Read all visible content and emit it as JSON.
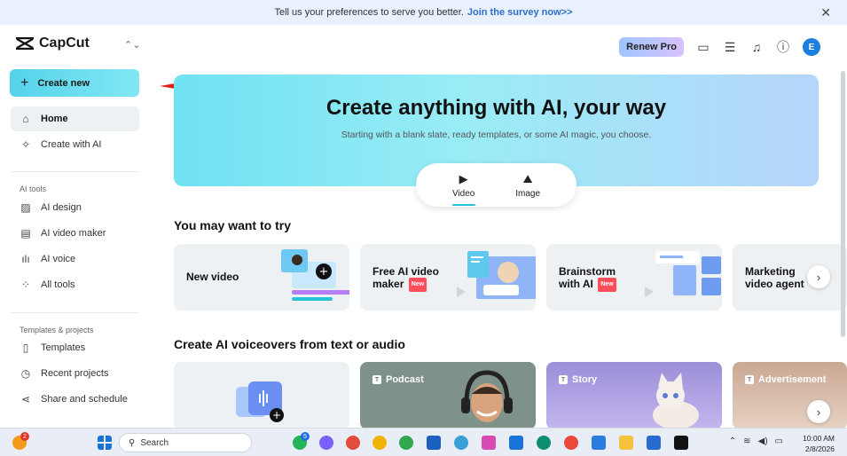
{
  "banner": {
    "text": "Tell us your preferences to serve you better.",
    "link": "Join the survey now>>",
    "close": "✕"
  },
  "sidebar": {
    "logo": "CapCut",
    "create_new": "Create new",
    "home": "Home",
    "create_with_ai": "Create with AI",
    "ai_tools_label": "AI tools",
    "ai_design": "AI design",
    "ai_video_maker": "AI video maker",
    "ai_voice": "AI voice",
    "all_tools": "All tools",
    "templates_label": "Templates & projects",
    "templates": "Templates",
    "recent_projects": "Recent projects",
    "share_schedule": "Share and schedule"
  },
  "topbar": {
    "renew": "Renew Pro",
    "avatar": "E"
  },
  "hero": {
    "title": "Create anything with AI, your way",
    "subtitle": "Starting with a blank slate, ready templates, or some AI magic, you choose.",
    "tabs": [
      {
        "label": "Video"
      },
      {
        "label": "Image"
      }
    ]
  },
  "try_section": {
    "heading": "You may want to try",
    "cards": [
      {
        "label": "New video"
      },
      {
        "label_line1": "Free AI video",
        "label_line2": "maker",
        "badge": "New"
      },
      {
        "label_line1": "Brainstorm",
        "label_line2": "with AI",
        "badge": "New"
      },
      {
        "label_line1": "Marketing",
        "label_line2": "video agent"
      }
    ]
  },
  "voice_section": {
    "heading": "Create AI voiceovers from text or audio",
    "cards": [
      {
        "tag": ""
      },
      {
        "tag": "Podcast"
      },
      {
        "tag": "Story"
      },
      {
        "tag": "Advertisement"
      }
    ]
  },
  "taskbar": {
    "search": "Search",
    "time": "10:00 AM",
    "date": "2/8/2026",
    "notif_count": "2",
    "whatsapp_count": "5"
  },
  "colors": {
    "accent": "#54d3ea",
    "avatar": "#1d7fe0",
    "badge": "#ff4d5a",
    "arrow": "#e31b1b"
  }
}
